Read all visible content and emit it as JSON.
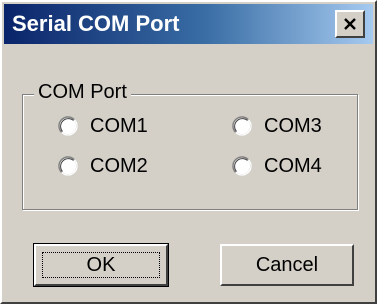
{
  "dialog": {
    "title": "Serial COM Port",
    "close_symbol": "×"
  },
  "group": {
    "label": "COM Port",
    "options": [
      {
        "label": "COM1",
        "checked": false
      },
      {
        "label": "COM2",
        "checked": false
      },
      {
        "label": "COM3",
        "checked": false
      },
      {
        "label": "COM4",
        "checked": false
      }
    ]
  },
  "buttons": {
    "ok_label": "OK",
    "cancel_label": "Cancel"
  },
  "colors": {
    "face": "#d4d0c8",
    "title_start": "#0a246a",
    "title_end": "#a6caf0"
  }
}
